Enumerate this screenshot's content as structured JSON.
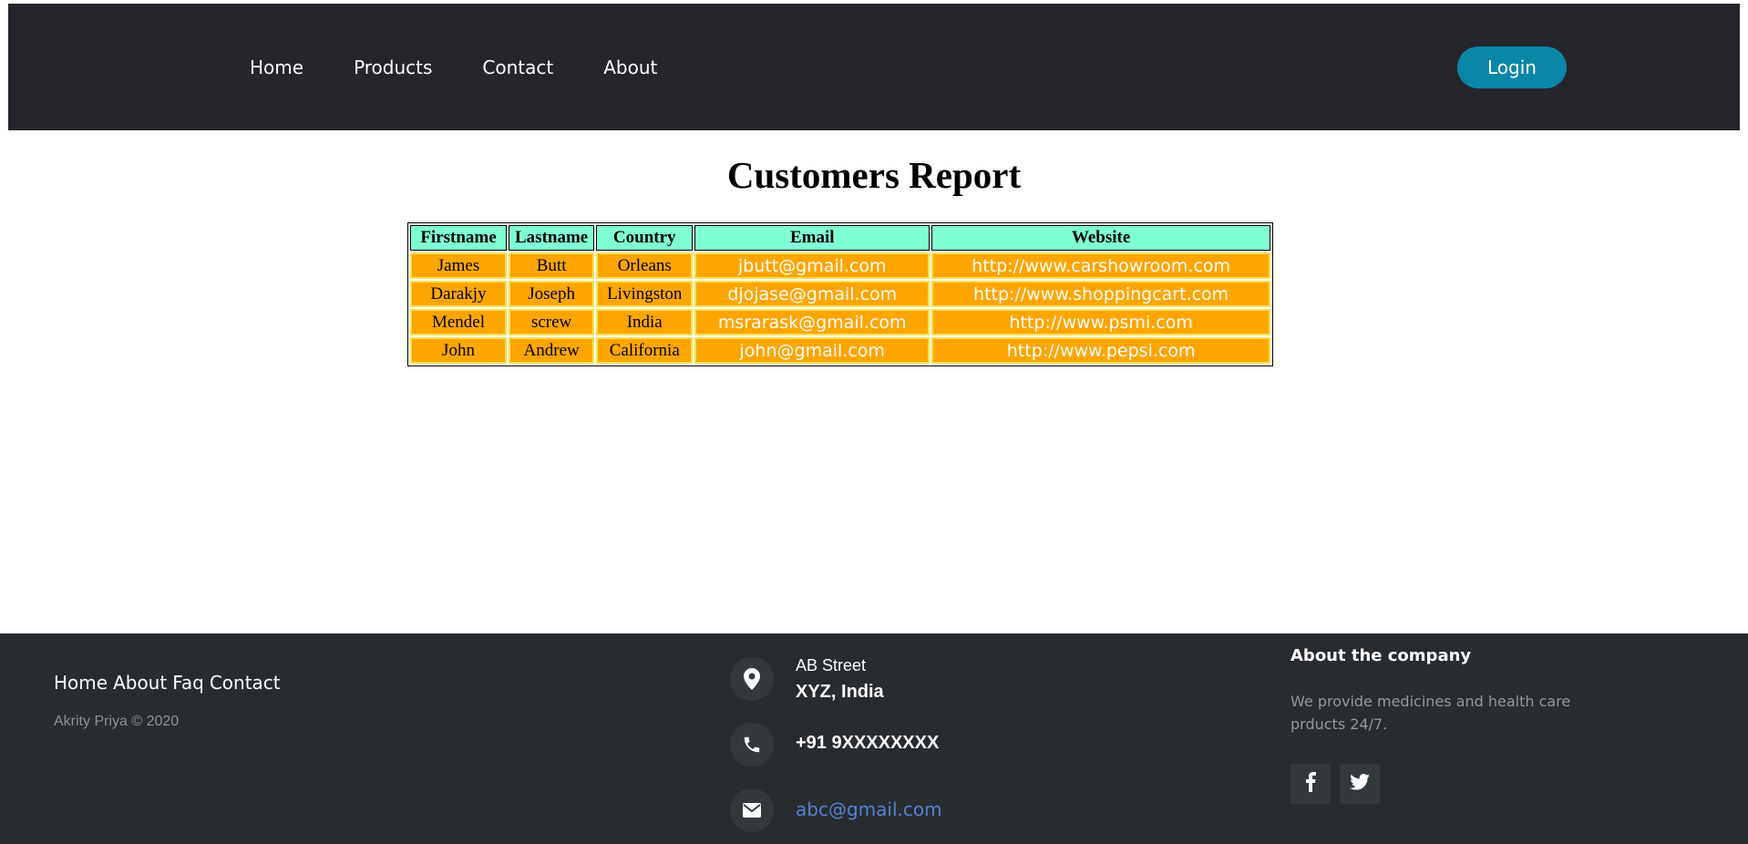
{
  "nav": {
    "links": [
      "Home",
      "Products",
      "Contact",
      "About"
    ],
    "login_label": "Login"
  },
  "report": {
    "title": "Customers Report",
    "columns": [
      "Firstname",
      "Lastname",
      "Country",
      "Email",
      "Website"
    ],
    "rows": [
      [
        "James",
        "Butt",
        "Orleans",
        "jbutt@gmail.com",
        "http://www.carshowroom.com"
      ],
      [
        "Darakjy",
        "Joseph",
        "Livingston",
        "djojase@gmail.com",
        "http://www.shoppingcart.com"
      ],
      [
        "Mendel",
        "screw",
        "India",
        "msrarask@gmail.com",
        "http://www.psmi.com"
      ],
      [
        "John",
        "Andrew",
        "California",
        "john@gmail.com",
        "http://www.pepsi.com"
      ]
    ]
  },
  "footer": {
    "links": [
      "Home",
      "About",
      "Faq",
      "Contact"
    ],
    "copyright": "Akrity Priya © 2020",
    "address_line1": "AB Street",
    "address_line2": "XYZ, India",
    "phone": "+91 9XXXXXXXX",
    "email": "abc@gmail.com",
    "about_heading": "About the company",
    "about_text": "We provide medicines and health care prducts 24/7.",
    "icons": [
      "map-marker-icon",
      "phone-icon",
      "envelope-icon",
      "facebook-icon",
      "twitter-icon"
    ]
  },
  "colors": {
    "nav_bg": "#25262b",
    "login_bg": "#0a86a8",
    "header_cell_bg": "#7fffd4",
    "body_cell_bg": "#ffa500",
    "footer_bg": "#292c2f",
    "email_link": "#5383d3"
  }
}
